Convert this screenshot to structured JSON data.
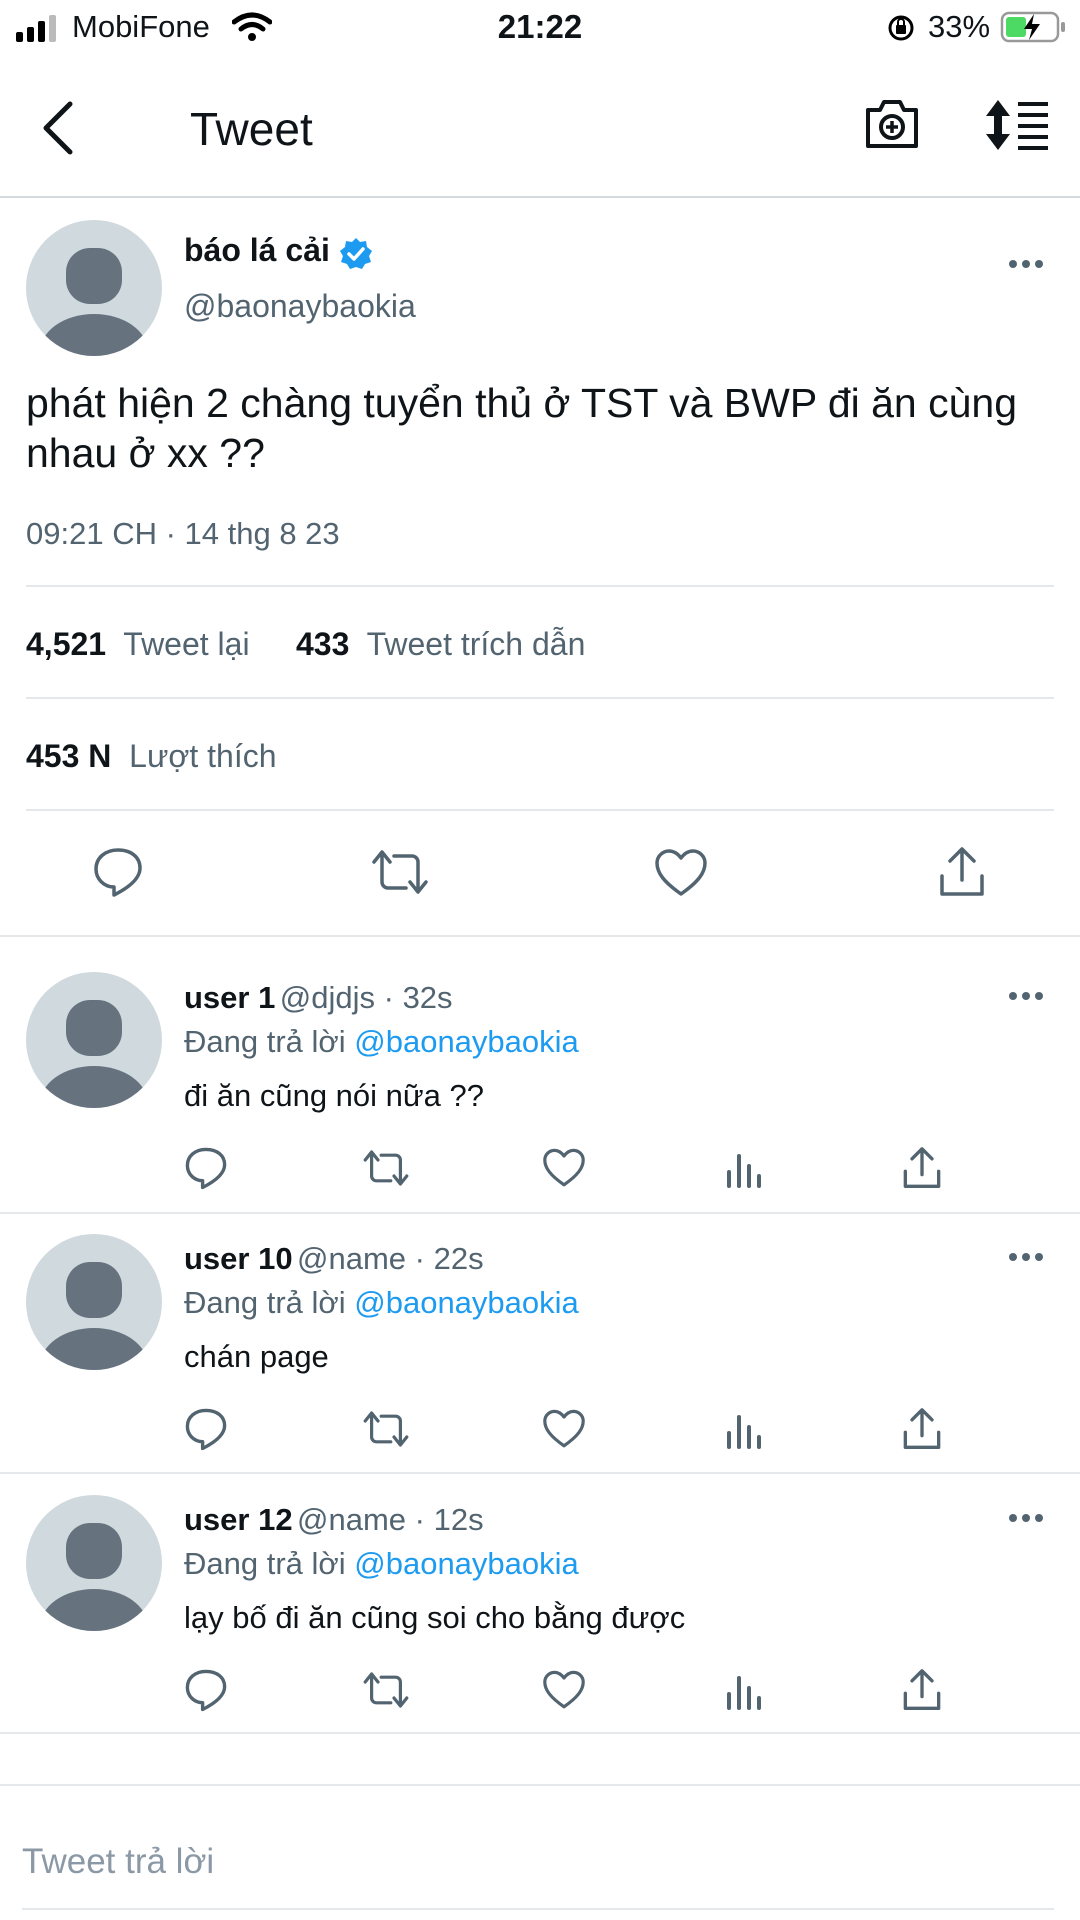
{
  "status_bar": {
    "carrier": "MobiFone",
    "time": "21:22",
    "battery": "33%"
  },
  "header": {
    "title": "Tweet"
  },
  "tweet": {
    "author_name": "báo lá cải",
    "author_handle": "@baonaybaokia",
    "text": "phát hiện 2 chàng tuyển thủ ở TST và BWP đi ăn cùng nhau ở xx ??",
    "timestamp": "09:21 CH · 14 thg 8 23",
    "retweets": "4,521",
    "retweets_label": "Tweet lại",
    "quotes": "433",
    "quotes_label": "Tweet trích dẫn",
    "likes": "453 N",
    "likes_label": "Lượt thích"
  },
  "replies": [
    {
      "name": "user 1",
      "meta": "@djdjs · 32s",
      "replying_label": "Đang trả lời",
      "replying_to": "@baonaybaokia",
      "text": "đi ăn cũng nói nữa ??"
    },
    {
      "name": "user 10",
      "meta": "@name · 22s",
      "replying_label": "Đang trả lời",
      "replying_to": "@baonaybaokia",
      "text": "chán page"
    },
    {
      "name": "user 12",
      "meta": "@name · 12s",
      "replying_label": "Đang trả lời",
      "replying_to": "@baonaybaokia",
      "text": "lạy bố đi ăn cũng soi cho bằng được"
    }
  ],
  "compose": {
    "placeholder": "Tweet trả lời"
  },
  "colors": {
    "accent": "#1d9bf0",
    "muted": "#536471",
    "avatar_bg": "#cfd9de",
    "avatar_fg": "#66737f",
    "battery_green": "#4cd964"
  }
}
